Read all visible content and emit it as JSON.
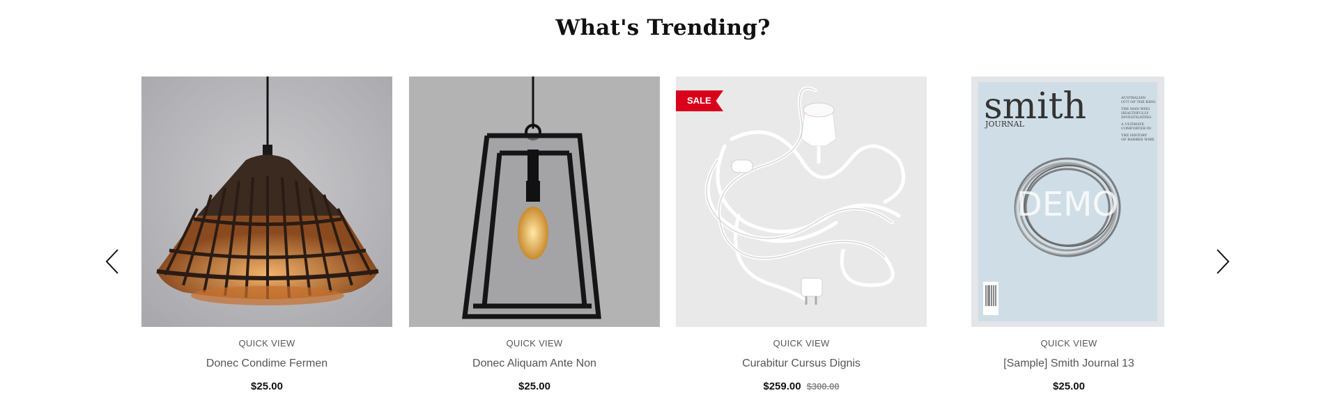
{
  "section": {
    "title": "What's Trending?"
  },
  "carousel": {
    "prev_icon": "chevron-left-icon",
    "next_icon": "chevron-right-icon"
  },
  "products": [
    {
      "image": "rattan-pendant-lamp",
      "quick_view": "QUICK VIEW",
      "name": "Donec Condime Fermen",
      "price": "$25.00"
    },
    {
      "image": "lantern-pendant-lamp",
      "quick_view": "QUICK VIEW",
      "name": "Donec Aliquam Ante Non",
      "price": "$25.00"
    },
    {
      "image": "white-cord-kit",
      "badge": "SALE",
      "quick_view": "QUICK VIEW",
      "name": "Curabitur Cursus Dignis",
      "price": "$259.00",
      "old_price": "$300.00"
    },
    {
      "image": "smith-journal-cover",
      "cover": {
        "masthead": "smith",
        "masthead_sub": "JOURNAL",
        "watermark": "DEMO",
        "cover_lines": [
          "AUSTRALIAN",
          "OUT OF THE KING",
          "THE MAN WHO",
          "HEALTHFULLY",
          "INVESTIGATING",
          "A ULTIMATE",
          "COMFORTER IN",
          "THE HISTORY",
          "OF BARBED WIRE"
        ]
      },
      "quick_view": "QUICK VIEW",
      "name": "[Sample] Smith Journal 13",
      "price": "$25.00"
    }
  ],
  "colors": {
    "accent": "#d9001b",
    "text": "#111111",
    "muted": "#555555"
  }
}
